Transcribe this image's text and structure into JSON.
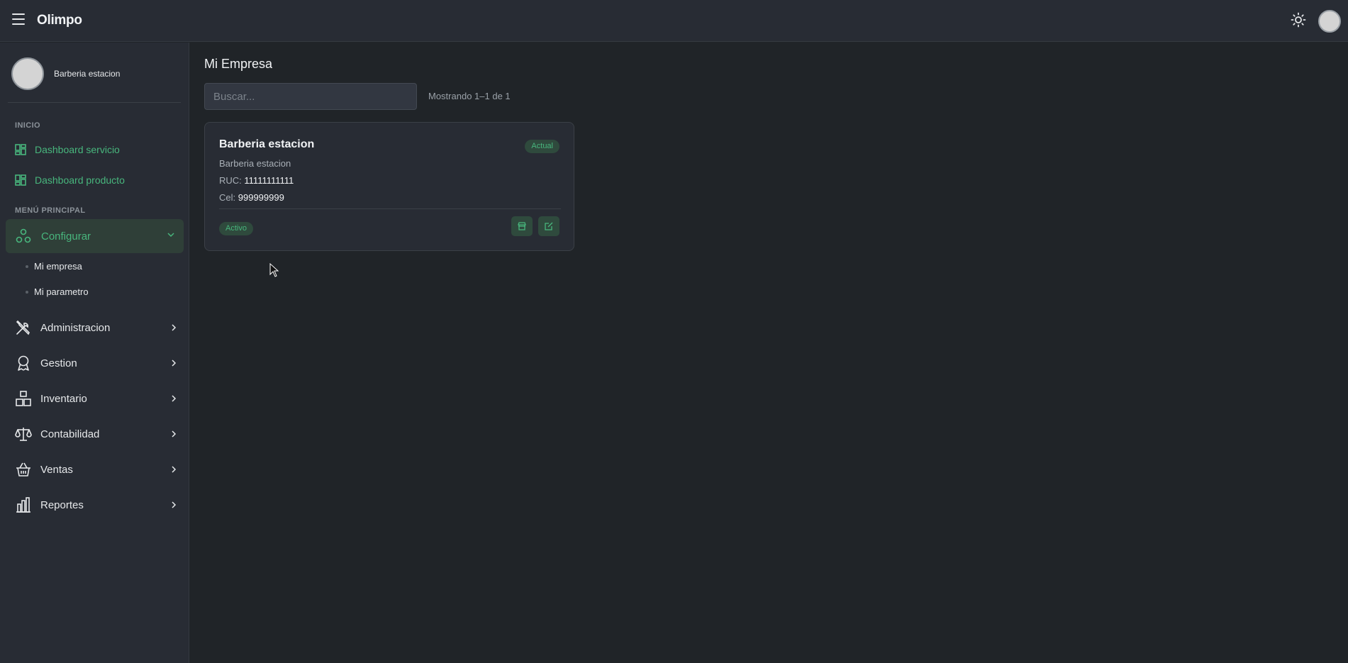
{
  "app": {
    "title": "Olimpo"
  },
  "icons": {
    "menu": "hamburger-icon",
    "theme": "sun-icon",
    "dashboard": "dashboard-grid-icon",
    "config": "nodes-icon",
    "admin": "tools-icon",
    "gestion": "award-icon",
    "inventario": "boxes-icon",
    "contabilidad": "scale-icon",
    "ventas": "basket-icon",
    "reportes": "bar-chart-icon",
    "store": "store-icon",
    "edit": "edit-icon"
  },
  "colors": {
    "accent": "#48b67d",
    "background": "#202428",
    "panel": "#282c34"
  },
  "sidebar": {
    "profile_name": "Barberia estacion",
    "section_inicio": "INICIO",
    "dashboard_servicio": "Dashboard servicio",
    "dashboard_producto": "Dashboard producto",
    "section_menu": "MENÚ PRINCIPAL",
    "configurar": "Configurar",
    "sub_items": [
      "Mi empresa",
      "Mi parametro"
    ],
    "items": [
      "Administracion",
      "Gestion",
      "Inventario",
      "Contabilidad",
      "Ventas",
      "Reportes"
    ]
  },
  "main": {
    "title": "Mi Empresa",
    "search_placeholder": "Buscar...",
    "results": "Mostrando 1–1 de 1",
    "card": {
      "title": "Barberia estacion",
      "badge_current": "Actual",
      "subtitle": "Barberia estacion",
      "ruc_label": "RUC:",
      "ruc_value": "11111111111",
      "cel_label": "Cel:",
      "cel_value": "999999999",
      "status": "Activo"
    }
  }
}
